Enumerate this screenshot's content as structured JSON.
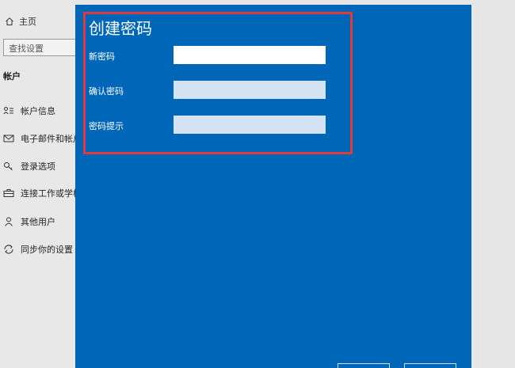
{
  "sidebar": {
    "home_label": "主页",
    "search_placeholder": "查找设置",
    "section_title": "帐户",
    "items": [
      {
        "label": "帐户信息",
        "icon": "account-info-icon"
      },
      {
        "label": "电子邮件和帐户",
        "icon": "email-icon"
      },
      {
        "label": "登录选项",
        "icon": "key-icon"
      },
      {
        "label": "连接工作或学校",
        "icon": "briefcase-icon"
      },
      {
        "label": "其他用户",
        "icon": "person-icon"
      },
      {
        "label": "同步你的设置",
        "icon": "sync-icon"
      }
    ]
  },
  "dialog": {
    "title": "创建密码",
    "fields": [
      {
        "label": "新密码",
        "value": ""
      },
      {
        "label": "确认密码",
        "value": ""
      },
      {
        "label": "密码提示",
        "value": ""
      }
    ],
    "buttons": [
      {
        "label": ""
      },
      {
        "label": ""
      }
    ]
  },
  "colors": {
    "dialog_bg": "#0067b8",
    "highlight": "#e03b3b",
    "sidebar_bg": "#e8e8e8"
  }
}
